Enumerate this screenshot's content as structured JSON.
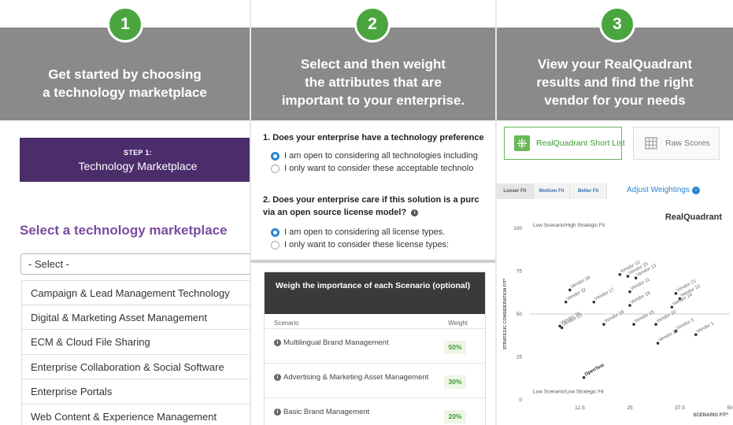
{
  "steps": [
    {
      "number": "1",
      "title_lines": [
        "Get started by choosing",
        "a technology marketplace"
      ]
    },
    {
      "number": "2",
      "title_lines": [
        "Select and then weight",
        "the attributes that are",
        "important to your enterprise."
      ]
    },
    {
      "number": "3",
      "title_lines": [
        "View your RealQuadrant",
        "results and find the right",
        "vendor for your needs"
      ]
    }
  ],
  "marketplace": {
    "step_label": "STEP 1:",
    "step_title": "Technology Marketplace",
    "heading": "Select a technology marketplace",
    "select_value": "- Select -",
    "items": [
      "Campaign & Lead Management Technology",
      "Digital & Marketing Asset Management",
      "ECM & Cloud File Sharing",
      "Enterprise Collaboration & Social Software",
      "Enterprise Portals",
      "Web Content & Experience Management"
    ]
  },
  "attributes": {
    "q1": "1. Does your enterprise have a technology preference",
    "q1_options": [
      "I am open to considering all technologies including",
      "I only want to consider these acceptable technolo"
    ],
    "q2_line1": "2. Does your enterprise care if this solution is a purc",
    "q2_line2": "via an open source license model?",
    "q2_options": [
      "I am open to considering all license types.",
      "I only want to consider these license types:"
    ],
    "weigh": {
      "title": "Weigh the importance of each Scenario (optional)",
      "col_scenario": "Scenario",
      "col_weight": "Weight",
      "rows": [
        {
          "name": "Multilingual Brand Management",
          "weight": "50%"
        },
        {
          "name": "Advertising & Marketing Asset Management",
          "weight": "30%"
        },
        {
          "name": "Basic Brand Management",
          "weight": "20%"
        }
      ]
    }
  },
  "results": {
    "tab_short_list": "RealQuadrant Short List",
    "tab_raw_scores": "Raw Scores",
    "fit_tabs": [
      "Looser Fit",
      "Medium Fit",
      "Better Fit"
    ],
    "adjust_weightings": "Adjust Weightings",
    "chart_title": "RealQuadrant",
    "colors": {
      "accent": "#4aa53f",
      "link": "#2a84d2",
      "purple": "#4c2d6b"
    }
  },
  "chart_data": {
    "type": "scatter",
    "title": "RealQuadrant",
    "xlabel": "SCENARIO FIT*",
    "ylabel": "STRATEGIC CONSIDERATION FIT*",
    "xlim": [
      0,
      50
    ],
    "ylim": [
      0,
      100
    ],
    "x_ticks": [
      "12.5",
      "25",
      "37.5",
      "50"
    ],
    "y_ticks": [
      "100",
      "75",
      "50",
      "25",
      "0"
    ],
    "corner_labels": {
      "top": "Low Scenario/High Strategic Fit",
      "bottom": "Low Scenario/Low Strategic Fit"
    },
    "points": [
      {
        "label": "Vendor 12",
        "x": 22.5,
        "y": 73
      },
      {
        "label": "Vendor 25",
        "x": 24.5,
        "y": 72
      },
      {
        "label": "Vendor 13",
        "x": 26.5,
        "y": 71
      },
      {
        "label": "Vendor 28",
        "x": 10,
        "y": 64
      },
      {
        "label": "Vendor 11",
        "x": 25,
        "y": 63
      },
      {
        "label": "Vendor 21",
        "x": 36.5,
        "y": 62
      },
      {
        "label": "Vendor 10",
        "x": 37.5,
        "y": 59
      },
      {
        "label": "Vendor 32",
        "x": 9,
        "y": 57
      },
      {
        "label": "Vendor 17",
        "x": 16,
        "y": 57
      },
      {
        "label": "Vendor 19",
        "x": 25,
        "y": 55
      },
      {
        "label": "Vendor 24",
        "x": 35.5,
        "y": 54
      },
      {
        "label": "Vendor 29",
        "x": 7.5,
        "y": 43
      },
      {
        "label": "Vendor 23",
        "x": 8,
        "y": 42
      },
      {
        "label": "Vendor 16",
        "x": 18.5,
        "y": 44
      },
      {
        "label": "Vendor 15",
        "x": 26,
        "y": 44
      },
      {
        "label": "Vendor 20",
        "x": 31.5,
        "y": 44
      },
      {
        "label": "Vendor 3",
        "x": 36.5,
        "y": 40
      },
      {
        "label": "Vendor 1",
        "x": 41.5,
        "y": 38
      },
      {
        "label": "Vendor 22",
        "x": 32,
        "y": 33
      },
      {
        "label": "OpenText",
        "x": 13.5,
        "y": 13
      }
    ]
  }
}
